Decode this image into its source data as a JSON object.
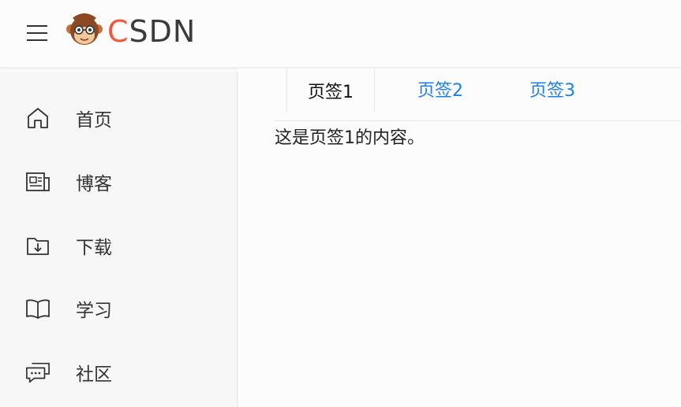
{
  "header": {
    "logo_c": "C",
    "logo_rest": "SDN"
  },
  "sidebar": {
    "items": [
      {
        "label": "首页",
        "icon": "home-icon"
      },
      {
        "label": "博客",
        "icon": "newspaper-icon"
      },
      {
        "label": "下载",
        "icon": "folder-download-icon"
      },
      {
        "label": "学习",
        "icon": "book-icon"
      },
      {
        "label": "社区",
        "icon": "chat-icon"
      }
    ]
  },
  "main": {
    "tabs": [
      {
        "label": "页签1",
        "active": true
      },
      {
        "label": "页签2",
        "active": false
      },
      {
        "label": "页签3",
        "active": false
      }
    ],
    "content": "这是页签1的内容。"
  },
  "colors": {
    "tab_link": "#1e7fe8",
    "logo_accent": "#f05a3c",
    "sidebar_bg": "#f7f7f8"
  }
}
